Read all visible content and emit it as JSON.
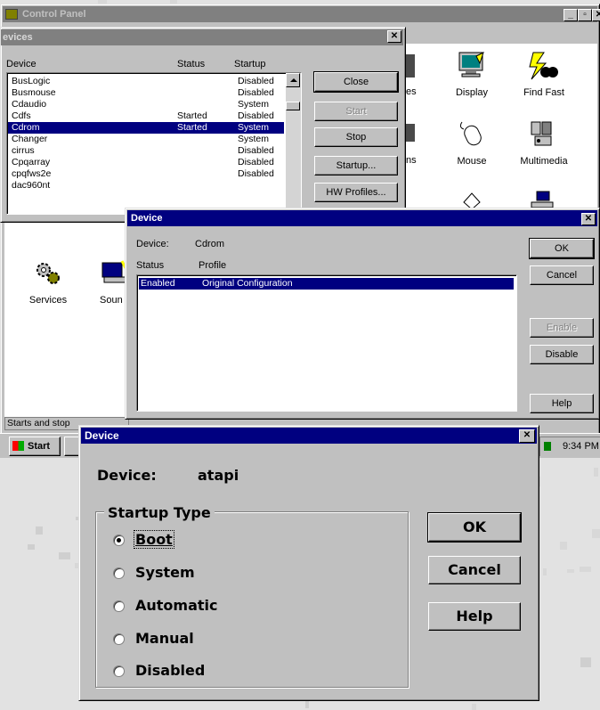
{
  "control_panel": {
    "title": "Control Panel",
    "icons": [
      "Display",
      "Find Fast",
      "Mouse",
      "Multimedia",
      "Services",
      "Soun"
    ],
    "partial_labels": [
      "es",
      "ns"
    ],
    "status_text": "Starts and stop",
    "min_glyph": "_",
    "max_glyph": "▫",
    "close_glyph": "✕"
  },
  "devices": {
    "title": "evices",
    "columns": [
      "Device",
      "Status",
      "Startup"
    ],
    "rows": [
      {
        "device": "BusLogic",
        "status": "",
        "startup": "Disabled"
      },
      {
        "device": "Busmouse",
        "status": "",
        "startup": "Disabled"
      },
      {
        "device": "Cdaudio",
        "status": "",
        "startup": "System"
      },
      {
        "device": "Cdfs",
        "status": "Started",
        "startup": "Disabled"
      },
      {
        "device": "Cdrom",
        "status": "Started",
        "startup": "System"
      },
      {
        "device": "Changer",
        "status": "",
        "startup": "System"
      },
      {
        "device": "cirrus",
        "status": "",
        "startup": "Disabled"
      },
      {
        "device": "Cpqarray",
        "status": "",
        "startup": "Disabled"
      },
      {
        "device": "cpqfws2e",
        "status": "",
        "startup": "Disabled"
      },
      {
        "device": "dac960nt",
        "status": "",
        "startup": ""
      }
    ],
    "buttons": {
      "close": "Close",
      "start": "Start",
      "stop": "Stop",
      "startup": "Startup...",
      "hw_profiles": "HW Profiles..."
    }
  },
  "device_profile": {
    "title": "Device",
    "device_label": "Device:",
    "device_value": "Cdrom",
    "status_header": "Status",
    "profile_header": "Profile",
    "row_status": "Enabled",
    "row_profile": "Original Configuration",
    "buttons": {
      "ok": "OK",
      "cancel": "Cancel",
      "enable": "Enable",
      "disable": "Disable",
      "help": "Help"
    }
  },
  "device_startup": {
    "title": "Device",
    "device_label": "Device:",
    "device_value": "atapi",
    "group_label": "Startup Type",
    "options": [
      "Boot",
      "System",
      "Automatic",
      "Manual",
      "Disabled"
    ],
    "selected": "Boot",
    "buttons": {
      "ok": "OK",
      "cancel": "Cancel",
      "help": "Help"
    }
  },
  "taskbar": {
    "start": "Start",
    "clock": "9:34 PM"
  }
}
